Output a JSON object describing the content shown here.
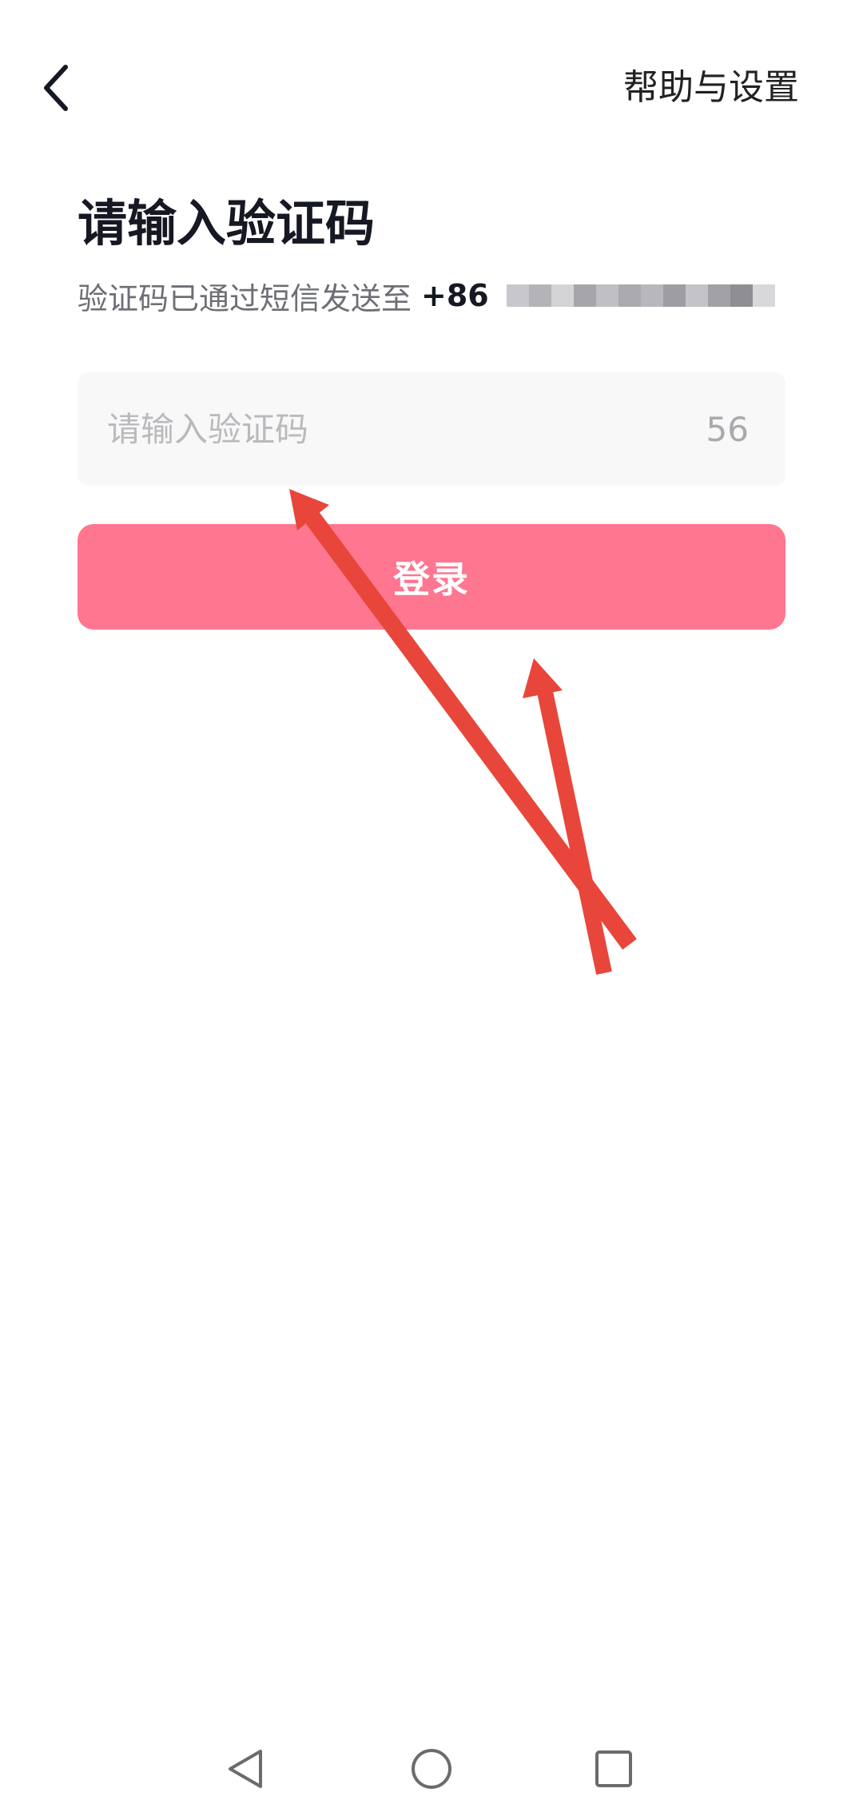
{
  "header": {
    "back_icon": "chevron-left-icon",
    "help_label": "帮助与设置"
  },
  "verification": {
    "title": "请输入验证码",
    "subtitle_prefix": "验证码已通过短信发送至",
    "country_code": "+86",
    "masked_phone_colors": [
      "#c8c8cc",
      "#b4b4b8",
      "#d4d4d7",
      "#a6a6aa",
      "#c0c0c4",
      "#ababaf",
      "#b8b8bc",
      "#9e9ea2",
      "#c4c4c8",
      "#a2a2a6",
      "#8f8f93",
      "#d8d8db"
    ],
    "input_placeholder": "请输入验证码",
    "input_value": "",
    "countdown": "56"
  },
  "login_button": {
    "label": "登录",
    "color": "#fe7690"
  },
  "annotation": {
    "arrow_color": "#e8463a"
  },
  "system_nav": {
    "back_icon": "triangle-back-icon",
    "home_icon": "circle-home-icon",
    "recents_icon": "square-recents-icon"
  }
}
